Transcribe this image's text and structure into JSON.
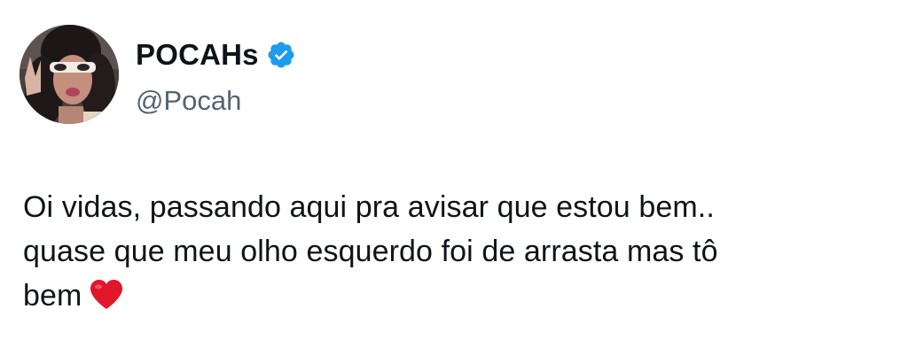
{
  "author": {
    "display_name": "POCAHs",
    "handle": "@Pocah",
    "verified": true,
    "verified_color": "#1d9bf0"
  },
  "avatar": {
    "icon": "profile-photo"
  },
  "tweet": {
    "line1": "Oi vidas, passando aqui pra avisar que estou bem..",
    "line2": "quase que meu olho esquerdo foi de arrasta mas tô",
    "line3": "bem",
    "emoji": "heart-icon",
    "emoji_color": "#e0162b"
  }
}
